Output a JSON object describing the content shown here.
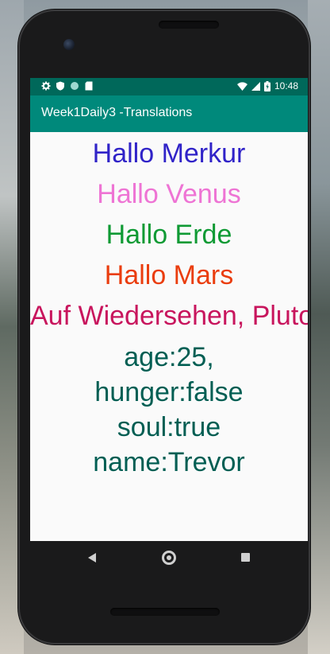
{
  "status_bar": {
    "time": "10:48",
    "icons_left": [
      "settings-icon",
      "shield-icon",
      "circle-icon",
      "sd-card-icon"
    ],
    "icons_right": [
      "wifi-icon",
      "signal-icon",
      "battery-icon"
    ]
  },
  "app_bar": {
    "title": "Week1Daily3 -Translations"
  },
  "greetings": [
    {
      "text": "Hallo Merkur",
      "color": "#3023c8"
    },
    {
      "text": "Hallo Venus",
      "color": "#ee74d4"
    },
    {
      "text": "Hallo Erde",
      "color": "#0f9a34"
    },
    {
      "text": "Hallo Mars",
      "color": "#ea3d0e"
    },
    {
      "text": "Auf Wiedersehen, Pluto",
      "color": "#c8155d"
    }
  ],
  "properties": {
    "color": "#005e53",
    "lines": [
      "age:25,",
      "hunger:false",
      "soul:true",
      "name:Trevor"
    ]
  },
  "colors": {
    "status_bar": "#00685a",
    "app_bar": "#00897b",
    "screen_background": "#fafafa"
  },
  "nav_bar": {
    "icons": [
      "back-icon",
      "home-icon",
      "recents-icon"
    ]
  }
}
